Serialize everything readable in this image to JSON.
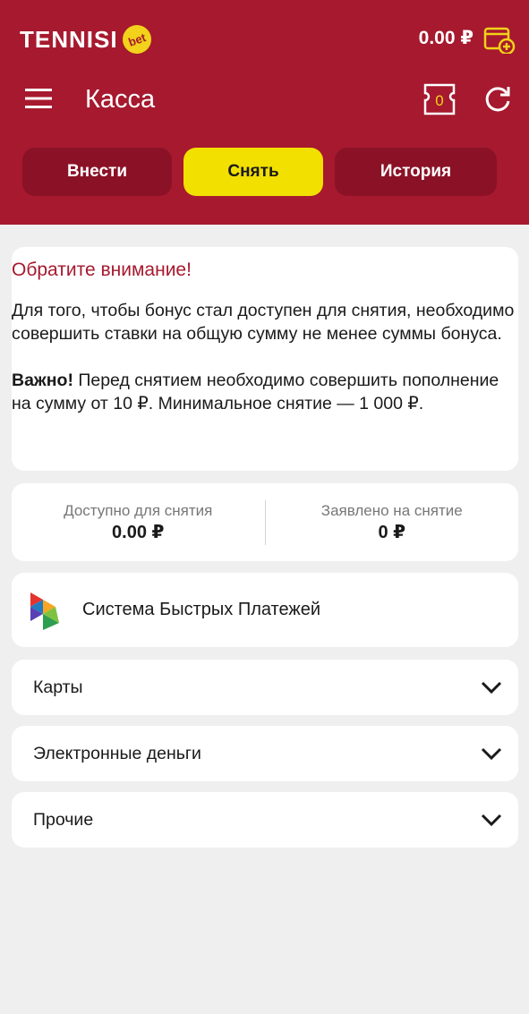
{
  "header": {
    "logo_text": "TENNISI",
    "logo_badge": "bet",
    "balance": "0.00 ₽",
    "title": "Касса",
    "betslip_count": "0",
    "colors": {
      "brand": "#a6192e",
      "accent": "#f2e000"
    },
    "icons": [
      "menu-icon",
      "wallet-add-icon",
      "betslip-icon",
      "refresh-icon"
    ]
  },
  "tabs": [
    {
      "label": "Внести",
      "active": false
    },
    {
      "label": "Снять",
      "active": true
    },
    {
      "label": "История",
      "active": false
    }
  ],
  "notice": {
    "title": "Обратите внимание!",
    "line1": "Для того, чтобы бонус стал доступен для снятия, необходимо совершить ставки на общую сумму не менее суммы бонуса.",
    "important": "Важно!",
    "line2": " Перед снятием необходимо совершить пополнение на сумму от 10 ₽. Минимальное снятие — 1 000 ₽."
  },
  "stats": {
    "available_label": "Доступно для снятия",
    "available_value": "0.00 ₽",
    "declared_label": "Заявлено на снятие",
    "declared_value": "0 ₽"
  },
  "methods": {
    "sbp_label": "Система Быстрых Платежей",
    "sections": [
      "Карты",
      "Электронные деньги",
      "Прочие"
    ]
  }
}
